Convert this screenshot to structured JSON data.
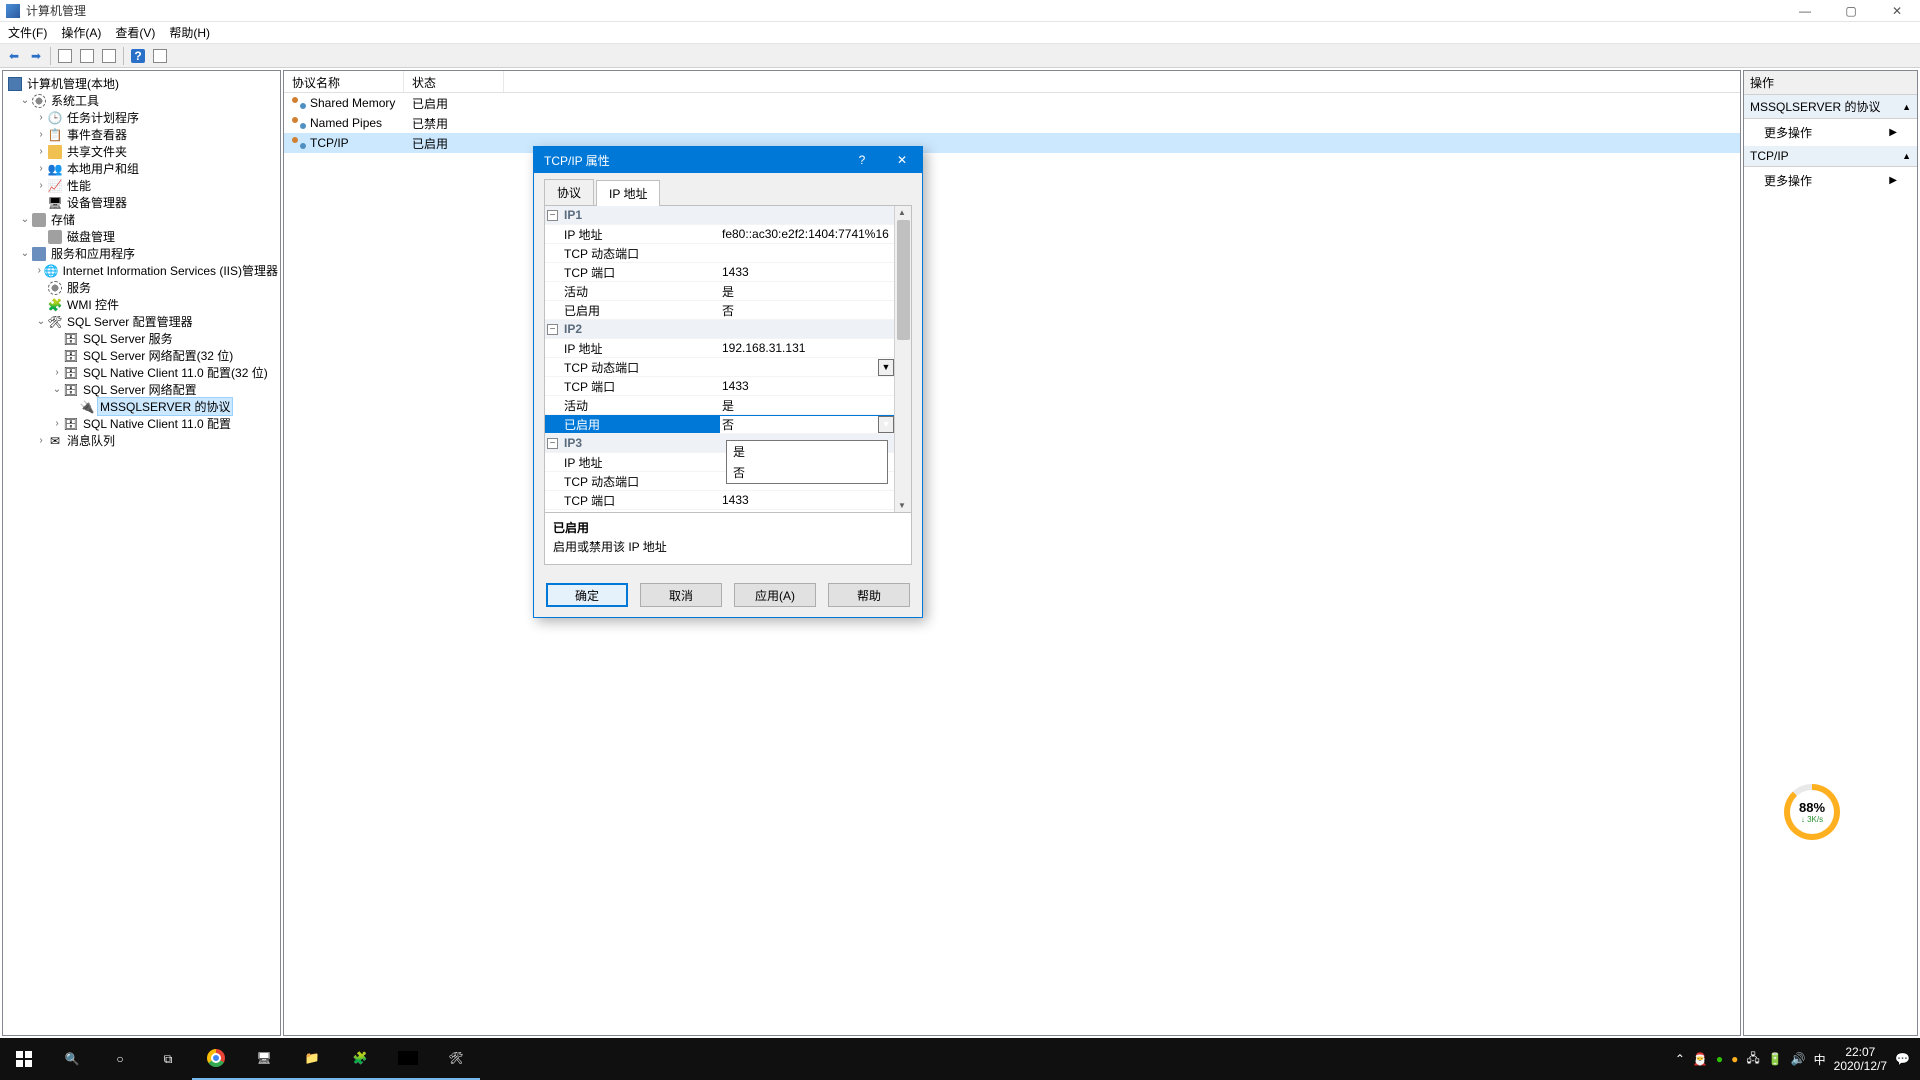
{
  "window": {
    "title": "计算机管理"
  },
  "menu": {
    "file": "文件(F)",
    "action": "操作(A)",
    "view": "查看(V)",
    "help": "帮助(H)"
  },
  "tree": {
    "root": "计算机管理(本地)",
    "sys_tools": "系统工具",
    "task_sched": "任务计划程序",
    "event_viewer": "事件查看器",
    "shared_folders": "共享文件夹",
    "local_users": "本地用户和组",
    "performance": "性能",
    "device_mgr": "设备管理器",
    "storage": "存储",
    "disk_mgmt": "磁盘管理",
    "services_apps": "服务和应用程序",
    "iis": "Internet Information Services (IIS)管理器",
    "services": "服务",
    "wmi": "WMI 控件",
    "sql_cfg_mgr": "SQL Server 配置管理器",
    "sql_services": "SQL Server 服务",
    "sql_net32": "SQL Server 网络配置(32 位)",
    "sql_native32": "SQL Native Client 11.0 配置(32 位)",
    "sql_net": "SQL Server 网络配置",
    "mssql_proto": "MSSQLSERVER 的协议",
    "sql_native": "SQL Native Client 11.0 配置",
    "msmq": "消息队列"
  },
  "list": {
    "col_name": "协议名称",
    "col_state": "状态",
    "rows": [
      {
        "name": "Shared Memory",
        "state": "已启用"
      },
      {
        "name": "Named Pipes",
        "state": "已禁用"
      },
      {
        "name": "TCP/IP",
        "state": "已启用"
      }
    ]
  },
  "actions": {
    "header": "操作",
    "section1": "MSSQLSERVER 的协议",
    "more1": "更多操作",
    "section2": "TCP/IP",
    "more2": "更多操作"
  },
  "dialog": {
    "title": "TCP/IP 属性",
    "tab_protocol": "协议",
    "tab_ip": "IP 地址",
    "groups": {
      "ip1": "IP1",
      "ip2": "IP2",
      "ip3": "IP3"
    },
    "labels": {
      "ip_addr": "IP 地址",
      "tcp_dyn": "TCP 动态端口",
      "tcp_port": "TCP 端口",
      "active": "活动",
      "enabled": "已启用"
    },
    "values": {
      "ip1_addr": "fe80::ac30:e2f2:1404:7741%16",
      "ip1_dyn": "",
      "ip1_port": "1433",
      "ip1_active": "是",
      "ip1_enabled": "否",
      "ip2_addr": "192.168.31.131",
      "ip2_dyn": "",
      "ip2_port": "1433",
      "ip2_active": "是",
      "ip2_enabled": "否",
      "ip3_addr": "",
      "ip3_dyn": "",
      "ip3_port": "1433"
    },
    "dropdown": {
      "opt_yes": "是",
      "opt_no": "否"
    },
    "desc_title": "已启用",
    "desc_text": "启用或禁用该 IP 地址",
    "btn_ok": "确定",
    "btn_cancel": "取消",
    "btn_apply": "应用(A)",
    "btn_help": "帮助"
  },
  "gauge": {
    "pct": "88%",
    "speed": "↓ 3K/s"
  },
  "tray": {
    "ime": "中",
    "time": "22:07",
    "date": "2020/12/7"
  }
}
